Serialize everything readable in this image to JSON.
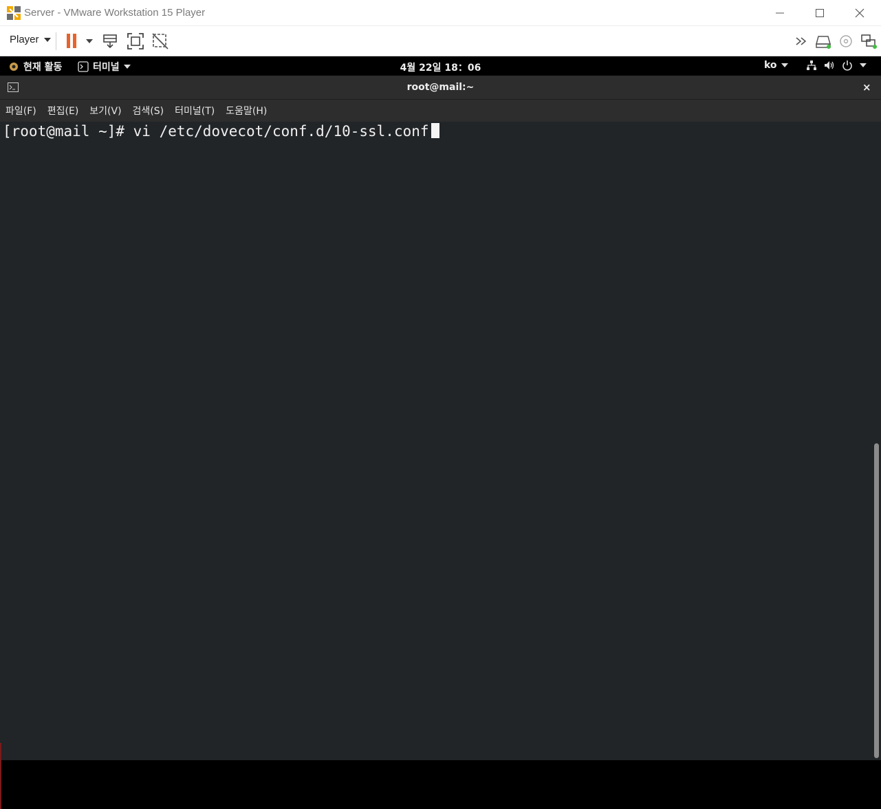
{
  "window": {
    "title": "Server - VMware Workstation 15 Player",
    "logo_icon": "vmware-logo-icon",
    "controls": [
      "minimize-icon",
      "maximize-icon",
      "close-icon"
    ]
  },
  "vm_toolbar": {
    "player_menu_label": "Player",
    "icons": [
      "pause-icon",
      "send-ctrl-alt-del-icon",
      "fullscreen-icon",
      "unity-icon",
      "more-icon",
      "hard-disk-icon",
      "cd-drive-icon",
      "network-adapter-icon"
    ],
    "accent_color": "#e8632b"
  },
  "gnome_bar": {
    "activities_label": "현재 활동",
    "app_label": "터미널",
    "clock": "4월 22일 18：06",
    "language": "ko",
    "tray_icons": [
      "network-icon",
      "volume-icon",
      "power-icon"
    ]
  },
  "terminal": {
    "title": "root@mail:~",
    "close_label": "×",
    "menus": [
      "파일(F)",
      "편집(E)",
      "보기(V)",
      "검색(S)",
      "터미널(T)",
      "도움말(H)"
    ],
    "prompt": "[root@mail ~]# ",
    "command": "vi /etc/dovecot/conf.d/10-ssl.conf"
  }
}
